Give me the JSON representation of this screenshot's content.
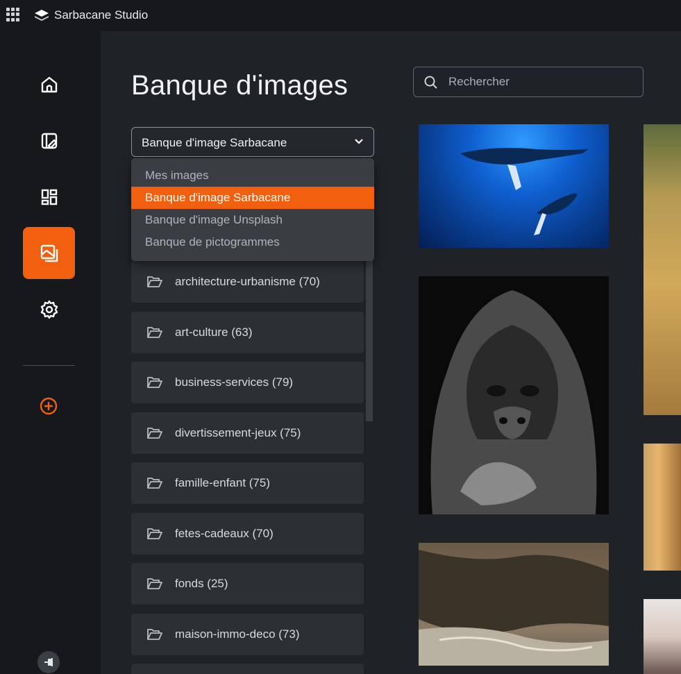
{
  "app": {
    "title": "Sarbacane Studio"
  },
  "page": {
    "title": "Banque d'images"
  },
  "search": {
    "placeholder": "Rechercher"
  },
  "source_select": {
    "selected": "Banque d'image Sarbacane",
    "options": [
      "Mes images",
      "Banque d'image Sarbacane",
      "Banque d'image Unsplash",
      "Banque de pictogrammes"
    ]
  },
  "categories": [
    "architecture-urbanisme (70)",
    "art-culture (63)",
    "business-services (79)",
    "divertissement-jeux (75)",
    "famille-enfant (75)",
    "fetes-cadeaux (70)",
    "fonds (25)",
    "maison-immo-deco (73)"
  ],
  "sidebar": {
    "items": [
      "home-icon",
      "editor-icon",
      "templates-icon",
      "images-icon",
      "settings-icon"
    ],
    "active": "images-icon"
  },
  "colors": {
    "accent": "#f2600f",
    "background": "#1f2226",
    "sidebar": "#16181b"
  }
}
